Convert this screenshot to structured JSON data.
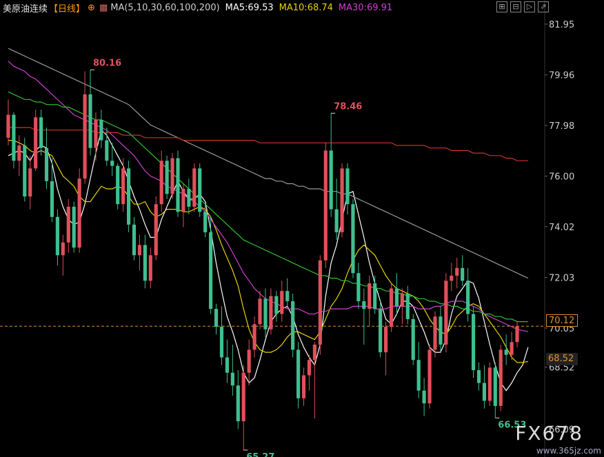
{
  "header": {
    "instrument": "美原油连续",
    "period": "【日线】",
    "ma_params": "MA(5,10,30,60,100,200)",
    "ma5": "MA5:69.53",
    "ma10": "MA10:68.74",
    "ma30": "MA30:69.91"
  },
  "colors": {
    "up": "#e0505a",
    "down": "#3fbf8f",
    "ma5": "#ffffff",
    "ma10": "#e8d200",
    "ma30": "#d040d0",
    "ma60": "#30c030",
    "ma100": "#9a9a9a",
    "ma200": "#d03030",
    "current_line": "#e09030",
    "axis_text": "#cccccc"
  },
  "price_tags": {
    "current": "70.12",
    "secondary": "68.52"
  },
  "watermark": {
    "main": "FX678",
    "sub": "www.365jz.com"
  },
  "chart_data": {
    "type": "candlestick",
    "y_axis_ticks": [
      "81.95",
      "79.96",
      "77.98",
      "76.00",
      "74.02",
      "72.03",
      "70.05",
      "68.52",
      "66.09"
    ],
    "ylim": [
      65.0,
      82.3
    ],
    "annotations": [
      {
        "label": "80.16",
        "value": 80.16,
        "kind": "high"
      },
      {
        "label": "78.46",
        "value": 78.46,
        "kind": "high"
      },
      {
        "label": "65.27",
        "value": 65.27,
        "kind": "low"
      },
      {
        "label": "66.53",
        "value": 66.53,
        "kind": "low"
      }
    ],
    "current_price": 70.12,
    "candles": [
      [
        77.5,
        79.0,
        77.2,
        78.4
      ],
      [
        78.4,
        78.5,
        76.3,
        76.6
      ],
      [
        76.6,
        77.6,
        76.0,
        77.2
      ],
      [
        77.2,
        77.5,
        75.0,
        75.2
      ],
      [
        75.2,
        76.8,
        74.7,
        76.3
      ],
      [
        76.3,
        78.6,
        76.2,
        78.3
      ],
      [
        78.3,
        78.6,
        76.8,
        77.1
      ],
      [
        77.1,
        77.9,
        75.5,
        75.8
      ],
      [
        75.8,
        76.7,
        74.2,
        74.4
      ],
      [
        74.4,
        74.7,
        72.5,
        72.9
      ],
      [
        72.9,
        73.7,
        72.1,
        73.4
      ],
      [
        73.4,
        75.1,
        73.0,
        74.8
      ],
      [
        74.8,
        75.0,
        73.0,
        73.2
      ],
      [
        73.2,
        76.3,
        73.0,
        75.9
      ],
      [
        75.9,
        80.1,
        75.7,
        79.2
      ],
      [
        79.2,
        80.16,
        76.8,
        77.1
      ],
      [
        77.1,
        78.5,
        76.6,
        78.2
      ],
      [
        78.2,
        78.6,
        77.1,
        77.4
      ],
      [
        77.4,
        77.9,
        76.4,
        76.6
      ],
      [
        76.6,
        77.3,
        76.0,
        76.4
      ],
      [
        76.4,
        76.5,
        74.7,
        74.9
      ],
      [
        74.9,
        76.7,
        74.6,
        76.3
      ],
      [
        76.3,
        76.6,
        73.8,
        74.1
      ],
      [
        74.1,
        74.4,
        72.7,
        72.9
      ],
      [
        72.9,
        73.7,
        72.3,
        73.3
      ],
      [
        73.3,
        73.7,
        71.6,
        71.9
      ],
      [
        71.9,
        73.2,
        71.6,
        72.9
      ],
      [
        72.9,
        75.2,
        72.7,
        74.9
      ],
      [
        74.9,
        77.0,
        74.6,
        76.6
      ],
      [
        76.6,
        76.8,
        75.1,
        75.3
      ],
      [
        75.3,
        76.9,
        75.1,
        76.7
      ],
      [
        76.7,
        77.0,
        74.4,
        74.6
      ],
      [
        74.6,
        75.7,
        74.0,
        75.5
      ],
      [
        75.5,
        75.9,
        74.5,
        74.8
      ],
      [
        74.8,
        76.5,
        74.6,
        76.3
      ],
      [
        76.3,
        76.5,
        74.4,
        74.6
      ],
      [
        74.6,
        74.9,
        73.6,
        73.8
      ],
      [
        73.8,
        74.4,
        70.6,
        70.8
      ],
      [
        70.8,
        71.0,
        69.8,
        70.1
      ],
      [
        70.1,
        70.9,
        68.6,
        68.9
      ],
      [
        68.9,
        69.6,
        67.9,
        68.3
      ],
      [
        68.3,
        69.4,
        67.4,
        67.8
      ],
      [
        67.8,
        68.4,
        66.1,
        66.4
      ],
      [
        66.4,
        68.6,
        65.27,
        68.3
      ],
      [
        68.3,
        69.6,
        67.8,
        69.2
      ],
      [
        69.2,
        70.5,
        68.9,
        70.2
      ],
      [
        70.2,
        71.5,
        70.0,
        71.2
      ],
      [
        71.2,
        71.6,
        69.7,
        70.0
      ],
      [
        70.0,
        71.6,
        69.8,
        71.3
      ],
      [
        71.3,
        71.5,
        70.3,
        70.6
      ],
      [
        70.6,
        71.9,
        70.3,
        71.5
      ],
      [
        71.5,
        72.0,
        70.9,
        71.1
      ],
      [
        71.1,
        71.4,
        68.9,
        69.2
      ],
      [
        69.2,
        69.5,
        66.9,
        67.3
      ],
      [
        67.3,
        68.5,
        67.0,
        68.2
      ],
      [
        68.2,
        69.0,
        67.6,
        68.8
      ],
      [
        68.8,
        69.5,
        66.5,
        69.4
      ],
      [
        69.4,
        72.9,
        69.0,
        72.7
      ],
      [
        72.7,
        77.3,
        72.4,
        77.0
      ],
      [
        77.0,
        78.46,
        74.4,
        74.7
      ],
      [
        74.7,
        75.9,
        73.5,
        73.8
      ],
      [
        73.8,
        76.5,
        73.6,
        76.3
      ],
      [
        76.3,
        76.5,
        74.5,
        74.9
      ],
      [
        74.9,
        75.1,
        72.0,
        72.2
      ],
      [
        72.2,
        72.6,
        70.8,
        71.1
      ],
      [
        71.1,
        71.6,
        69.4,
        70.8
      ],
      [
        70.8,
        72.1,
        70.1,
        71.8
      ],
      [
        71.8,
        72.1,
        70.6,
        70.8
      ],
      [
        70.8,
        71.1,
        68.9,
        69.1
      ],
      [
        69.1,
        70.3,
        68.2,
        70.1
      ],
      [
        70.1,
        71.8,
        69.9,
        71.6
      ],
      [
        71.6,
        72.2,
        70.6,
        70.9
      ],
      [
        70.9,
        71.6,
        70.2,
        71.4
      ],
      [
        71.4,
        71.7,
        70.2,
        70.4
      ],
      [
        70.4,
        70.6,
        68.6,
        68.8
      ],
      [
        68.8,
        69.5,
        67.3,
        67.6
      ],
      [
        67.6,
        68.1,
        66.6,
        67.1
      ],
      [
        67.1,
        69.4,
        66.9,
        69.2
      ],
      [
        69.2,
        70.7,
        68.9,
        70.5
      ],
      [
        70.5,
        70.9,
        69.1,
        69.4
      ],
      [
        69.4,
        72.2,
        69.1,
        71.9
      ],
      [
        71.9,
        72.6,
        71.5,
        72.1
      ],
      [
        72.1,
        72.8,
        71.6,
        72.4
      ],
      [
        72.4,
        72.9,
        71.7,
        71.9
      ],
      [
        71.9,
        72.4,
        70.3,
        70.6
      ],
      [
        70.6,
        70.9,
        68.1,
        68.4
      ],
      [
        68.4,
        68.7,
        67.6,
        67.9
      ],
      [
        67.9,
        68.6,
        66.9,
        67.2
      ],
      [
        67.2,
        68.7,
        67.0,
        68.5
      ],
      [
        68.5,
        68.7,
        66.53,
        67.0
      ],
      [
        67.0,
        69.4,
        66.8,
        69.2
      ],
      [
        69.2,
        69.8,
        68.6,
        69.0
      ],
      [
        69.0,
        69.9,
        68.8,
        69.5
      ],
      [
        69.5,
        70.3,
        69.3,
        70.12
      ]
    ],
    "ma_lines": [
      {
        "name": "MA5",
        "color_key": "ma5",
        "values": [
          76.8,
          76.9,
          77.0,
          76.9,
          76.6,
          77.0,
          77.2,
          77.1,
          76.5,
          75.5,
          74.8,
          74.3,
          74.1,
          74.2,
          74.9,
          75.9,
          76.9,
          77.8,
          77.6,
          77.2,
          76.8,
          76.4,
          75.8,
          75.2,
          74.7,
          74.1,
          73.6,
          73.6,
          74.3,
          74.8,
          75.3,
          75.8,
          75.4,
          75.1,
          75.1,
          75.3,
          75.0,
          73.9,
          72.6,
          71.5,
          70.5,
          69.9,
          69.2,
          68.3,
          67.9,
          68.1,
          68.8,
          69.6,
          70.3,
          70.6,
          70.8,
          70.9,
          70.5,
          69.8,
          69.3,
          68.9,
          68.6,
          69.4,
          71.3,
          72.6,
          73.3,
          74.3,
          75.3,
          75.4,
          74.5,
          73.6,
          72.6,
          71.8,
          71.1,
          70.4,
          70.2,
          70.6,
          71.1,
          71.1,
          70.9,
          70.4,
          69.9,
          69.3,
          69.1,
          69.1,
          69.6,
          70.6,
          71.3,
          71.6,
          71.9,
          71.8,
          71.2,
          70.3,
          69.4,
          68.6,
          67.9,
          67.6,
          67.9,
          68.3,
          68.6,
          69.3
        ]
      },
      {
        "name": "MA10",
        "color_key": "ma10",
        "values": [
          77.4,
          77.4,
          77.3,
          77.2,
          77.0,
          76.9,
          77.0,
          76.9,
          76.8,
          76.4,
          76.0,
          75.8,
          75.6,
          75.2,
          75.0,
          75.0,
          75.3,
          75.6,
          75.5,
          75.5,
          75.6,
          75.5,
          75.2,
          74.9,
          74.9,
          75.0,
          74.6,
          74.4,
          74.5,
          74.7,
          74.7,
          74.7,
          74.6,
          74.6,
          74.7,
          74.8,
          74.7,
          74.4,
          73.9,
          73.3,
          72.8,
          72.3,
          71.7,
          70.8,
          70.0,
          69.5,
          69.2,
          69.1,
          69.1,
          69.2,
          69.4,
          69.7,
          69.9,
          69.9,
          69.8,
          69.7,
          69.6,
          69.9,
          70.4,
          70.9,
          71.2,
          71.6,
          72.2,
          72.7,
          73.1,
          73.3,
          73.1,
          72.9,
          72.5,
          72.1,
          71.8,
          71.6,
          71.5,
          71.4,
          71.3,
          71.1,
          70.8,
          70.4,
          70.1,
          69.9,
          69.8,
          70.1,
          70.5,
          70.7,
          70.9,
          71.0,
          70.9,
          70.6,
          70.3,
          70.0,
          69.7,
          69.3,
          68.9,
          68.7,
          68.7,
          68.74
        ]
      },
      {
        "name": "MA30",
        "color_key": "ma30",
        "values": [
          80.5,
          80.3,
          80.2,
          80.1,
          79.9,
          79.8,
          79.6,
          79.4,
          79.2,
          79.0,
          78.8,
          78.6,
          78.4,
          78.3,
          78.2,
          78.1,
          78.0,
          77.9,
          77.8,
          77.6,
          77.4,
          77.2,
          77.0,
          76.8,
          76.5,
          76.2,
          76.0,
          75.9,
          75.8,
          75.6,
          75.5,
          75.4,
          75.3,
          75.1,
          75.0,
          74.8,
          74.6,
          74.3,
          74.0,
          73.7,
          73.4,
          73.0,
          72.6,
          72.2,
          71.9,
          71.6,
          71.4,
          71.2,
          71.1,
          71.0,
          70.9,
          70.8,
          70.8,
          70.8,
          70.7,
          70.6,
          70.6,
          70.7,
          70.7,
          70.8,
          70.8,
          70.8,
          70.8,
          70.9,
          70.9,
          70.9,
          70.9,
          70.8,
          70.8,
          70.8,
          70.9,
          70.9,
          70.9,
          70.9,
          70.9,
          70.8,
          70.8,
          70.8,
          70.9,
          70.9,
          71.0,
          71.1,
          71.1,
          71.1,
          71.0,
          70.9,
          70.8,
          70.6,
          70.5,
          70.4,
          70.3,
          70.2,
          70.1,
          70.0,
          69.95,
          69.91
        ]
      },
      {
        "name": "MA60",
        "color_key": "ma60",
        "values": [
          79.3,
          79.2,
          79.1,
          79.0,
          79.0,
          78.9,
          78.9,
          78.8,
          78.8,
          78.8,
          78.7,
          78.7,
          78.6,
          78.5,
          78.4,
          78.3,
          78.2,
          78.2,
          78.1,
          78.0,
          77.9,
          77.8,
          77.7,
          77.5,
          77.3,
          77.1,
          76.9,
          76.7,
          76.5,
          76.3,
          76.1,
          75.9,
          75.7,
          75.5,
          75.3,
          75.1,
          74.9,
          74.7,
          74.5,
          74.3,
          74.1,
          73.9,
          73.7,
          73.5,
          73.4,
          73.3,
          73.2,
          73.1,
          73.0,
          72.9,
          72.8,
          72.7,
          72.6,
          72.5,
          72.4,
          72.3,
          72.2,
          72.1,
          72.1,
          72.0,
          72.0,
          71.9,
          71.9,
          71.8,
          71.8,
          71.7,
          71.7,
          71.6,
          71.6,
          71.5,
          71.5,
          71.4,
          71.4,
          71.3,
          71.3,
          71.2,
          71.2,
          71.1,
          71.1,
          71.0,
          71.0,
          70.9,
          70.9,
          70.8,
          70.8,
          70.7,
          70.7,
          70.6,
          70.6,
          70.5,
          70.5,
          70.4,
          70.4,
          70.3,
          70.3,
          70.3
        ]
      },
      {
        "name": "MA100",
        "color_key": "ma100",
        "values": [
          81.0,
          80.9,
          80.8,
          80.7,
          80.6,
          80.5,
          80.4,
          80.3,
          80.2,
          80.1,
          80.0,
          79.9,
          79.8,
          79.7,
          79.6,
          79.5,
          79.4,
          79.3,
          79.2,
          79.1,
          79.0,
          78.9,
          78.8,
          78.6,
          78.4,
          78.2,
          78.0,
          77.9,
          77.8,
          77.7,
          77.6,
          77.5,
          77.4,
          77.3,
          77.2,
          77.1,
          77.0,
          76.9,
          76.8,
          76.7,
          76.6,
          76.5,
          76.4,
          76.3,
          76.2,
          76.1,
          76.0,
          75.9,
          75.9,
          75.8,
          75.8,
          75.7,
          75.7,
          75.6,
          75.6,
          75.5,
          75.5,
          75.5,
          75.4,
          75.4,
          75.4,
          75.3,
          75.3,
          75.2,
          75.1,
          75.0,
          74.9,
          74.8,
          74.7,
          74.6,
          74.5,
          74.4,
          74.3,
          74.2,
          74.1,
          74.0,
          73.9,
          73.8,
          73.7,
          73.6,
          73.5,
          73.4,
          73.3,
          73.2,
          73.1,
          73.0,
          72.9,
          72.8,
          72.7,
          72.6,
          72.5,
          72.4,
          72.3,
          72.2,
          72.1,
          72.0
        ]
      },
      {
        "name": "MA200",
        "color_key": "ma200",
        "values": [
          77.9,
          77.9,
          77.9,
          77.9,
          77.9,
          77.8,
          77.8,
          77.8,
          77.8,
          77.8,
          77.8,
          77.8,
          77.8,
          77.8,
          77.8,
          77.8,
          77.7,
          77.7,
          77.7,
          77.7,
          77.7,
          77.6,
          77.6,
          77.6,
          77.6,
          77.5,
          77.5,
          77.5,
          77.5,
          77.5,
          77.5,
          77.5,
          77.4,
          77.4,
          77.4,
          77.4,
          77.4,
          77.4,
          77.4,
          77.4,
          77.4,
          77.4,
          77.4,
          77.4,
          77.4,
          77.4,
          77.3,
          77.3,
          77.3,
          77.3,
          77.3,
          77.3,
          77.3,
          77.3,
          77.3,
          77.3,
          77.3,
          77.3,
          77.3,
          77.3,
          77.3,
          77.3,
          77.3,
          77.3,
          77.3,
          77.3,
          77.3,
          77.3,
          77.3,
          77.3,
          77.3,
          77.2,
          77.2,
          77.2,
          77.2,
          77.2,
          77.2,
          77.1,
          77.1,
          77.1,
          77.1,
          77.0,
          77.0,
          77.0,
          77.0,
          76.9,
          76.9,
          76.9,
          76.8,
          76.8,
          76.8,
          76.7,
          76.7,
          76.6,
          76.6,
          76.6
        ]
      }
    ]
  }
}
